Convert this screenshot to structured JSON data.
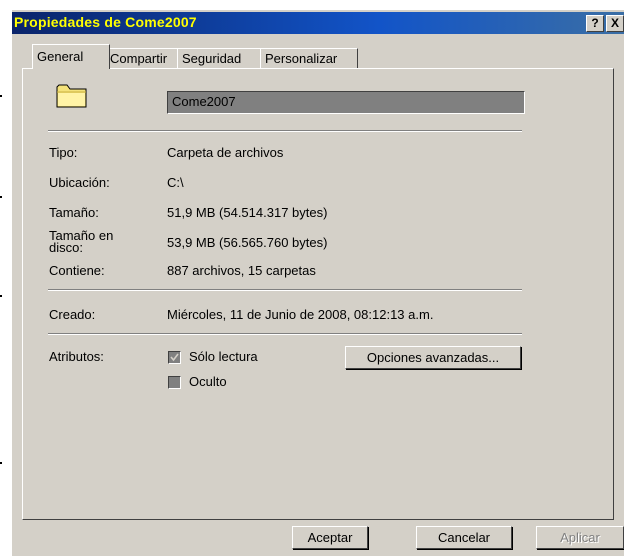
{
  "window": {
    "title": "Propiedades de Come2007",
    "help_glyph": "?",
    "close_glyph": "X"
  },
  "tabs": [
    {
      "label": "General",
      "active": true
    },
    {
      "label": "Compartir",
      "active": false
    },
    {
      "label": "Seguridad",
      "active": false
    },
    {
      "label": "Personalizar",
      "active": false
    }
  ],
  "general": {
    "folder_icon": "folder-icon",
    "name_value": "Come2007",
    "type_label": "Tipo:",
    "type_value": "Carpeta de archivos",
    "location_label": "Ubicación:",
    "location_value": "C:\\",
    "size_label": "Tamaño:",
    "size_value": "51,9 MB (54.514.317 bytes)",
    "disk_size_label_line1": "Tamaño en",
    "disk_size_label_line2": "disco:",
    "disk_size_value": "53,9 MB (56.565.760 bytes)",
    "contains_label": "Contiene:",
    "contains_value": "887 archivos, 15 carpetas",
    "created_label": "Creado:",
    "created_value": "Miércoles, 11 de Junio de 2008, 08:12:13 a.m.",
    "attributes_label": "Atributos:",
    "readonly_label": "Sólo lectura",
    "readonly_checked": true,
    "hidden_label": "Oculto",
    "hidden_checked": false,
    "advanced_button": "Opciones avanzadas..."
  },
  "footer": {
    "ok": "Aceptar",
    "cancel": "Cancelar",
    "apply": "Aplicar"
  },
  "colors": {
    "title_text": "#ffff00",
    "title_bar": "#0a246a",
    "face": "#d4d0c8",
    "disabled_text": "#808080"
  }
}
